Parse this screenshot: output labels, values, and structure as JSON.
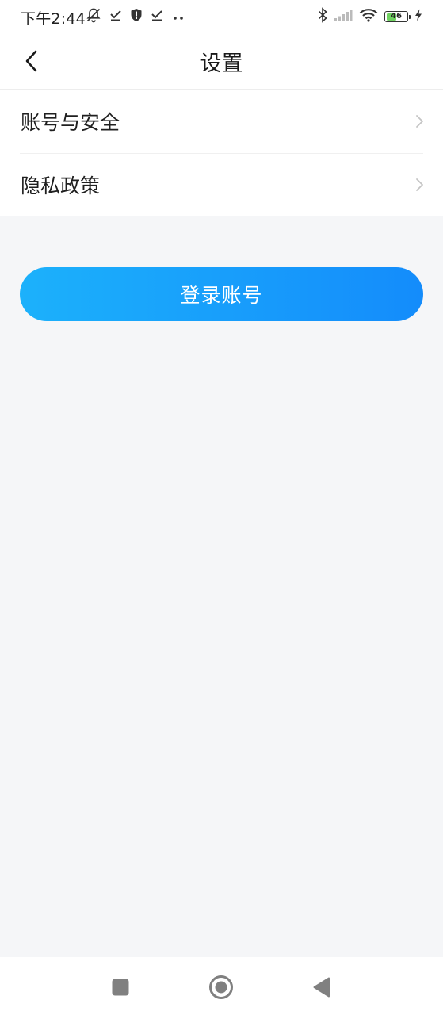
{
  "status_bar": {
    "time": "下午2:44",
    "battery_level": "46",
    "icons": [
      "notifications-muted-icon",
      "download-done-icon",
      "shield-icon",
      "download-done-icon",
      "more-dots-icon",
      "bluetooth-icon",
      "signal-icon",
      "wifi-icon",
      "battery-icon",
      "charging-icon"
    ],
    "battery_fill_color": "#6fd160"
  },
  "nav_bar": {
    "title": "设置",
    "back_icon": "chevron-left-icon"
  },
  "settings": {
    "items": [
      {
        "label": "账号与安全",
        "icon": "chevron-right-icon"
      },
      {
        "label": "隐私政策",
        "icon": "chevron-right-icon"
      }
    ]
  },
  "login_button": {
    "label": "登录账号",
    "gradient_start": "#1cb1fb",
    "gradient_end": "#148cfb"
  },
  "system_nav": {
    "buttons": [
      "recents-square-icon",
      "home-circle-icon",
      "back-triangle-icon"
    ]
  }
}
